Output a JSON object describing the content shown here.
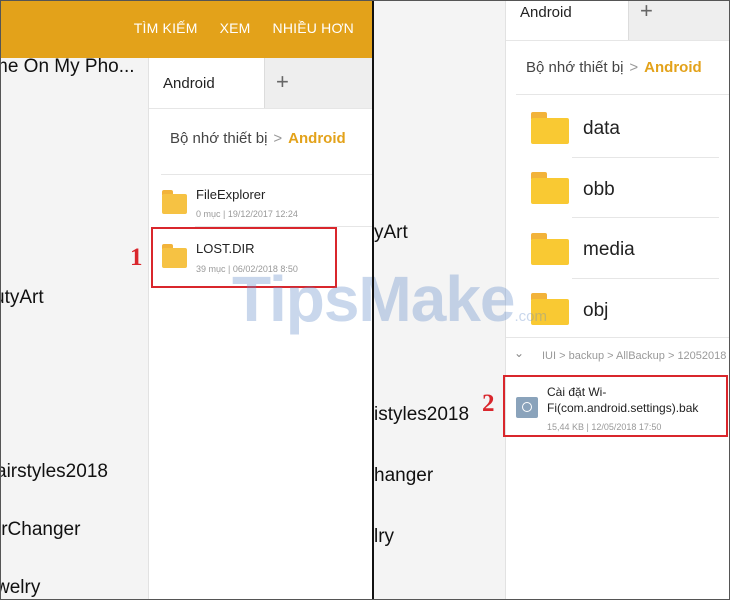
{
  "left": {
    "toolbar": {
      "actions": [
        "TÌM KIẾM",
        "XEM",
        "NHIỀU HƠN"
      ]
    },
    "background_list": [
      "me On My Pho...",
      "utyArt",
      "airstyles2018",
      "irChanger",
      "welry"
    ],
    "tabs": {
      "active": "Android",
      "add_icon": "+"
    },
    "breadcrumb": {
      "root": "Bộ nhớ thiết bị",
      "separator": ">",
      "current": "Android"
    },
    "files": [
      {
        "name": "FileExplorer",
        "count": "0 mục",
        "date": "19/12/2017 12:24"
      },
      {
        "name": "LOST.DIR",
        "count": "39 mục",
        "date": "06/02/2018 8:50"
      }
    ],
    "step": "1"
  },
  "right": {
    "background_list": [
      "yArt",
      "istyles2018",
      "hanger",
      "lry"
    ],
    "tabs": {
      "active": "Android",
      "add_icon": "+"
    },
    "breadcrumb": {
      "root": "Bộ nhớ thiết bị",
      "separator": ">",
      "current": "Android"
    },
    "folders": [
      "data",
      "obb",
      "media",
      "obj"
    ],
    "path": {
      "chevron": "⌄",
      "text": "IUI > backup > AllBackup > 12052018"
    },
    "bak_file": {
      "name_line1": "Cài đặt Wi-",
      "name_line2": "Fi(com.android.settings).bak",
      "size": "15,44 KB",
      "date": "12/05/2018 17:50"
    },
    "step": "2"
  },
  "watermark": {
    "main": "TipsMake",
    "suffix": ".com"
  },
  "colors": {
    "accent": "#e3a21a",
    "folder": "#f6c243",
    "highlight": "#d9262c"
  }
}
